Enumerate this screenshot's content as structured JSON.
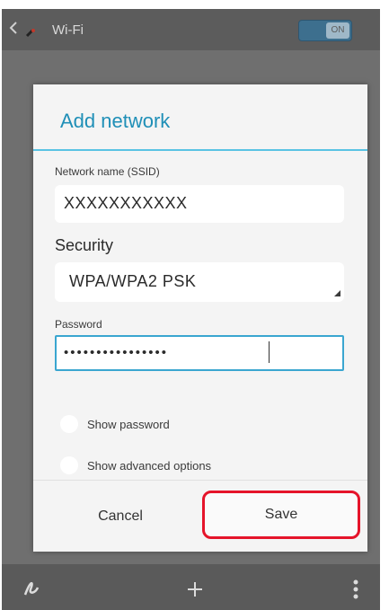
{
  "action_bar": {
    "title": "Wi-Fi",
    "toggle_label": "ON"
  },
  "dialog": {
    "title": "Add network",
    "ssid_label": "Network name (SSID)",
    "ssid_value": "XXXXXXXXXXX",
    "security_label": "Security",
    "security_value": "WPA/WPA2 PSK",
    "password_label": "Password",
    "password_value": "••••••••••••••••",
    "show_password_label": "Show password",
    "show_advanced_label": "Show advanced options",
    "cancel_label": "Cancel",
    "save_label": "Save"
  },
  "bottom_bar": {
    "icons": [
      "wps-icon",
      "add-icon",
      "overflow-menu-icon"
    ]
  },
  "colors": {
    "accent": "#1f8fb7",
    "divider": "#59c3e3",
    "highlight": "#e5142a"
  }
}
